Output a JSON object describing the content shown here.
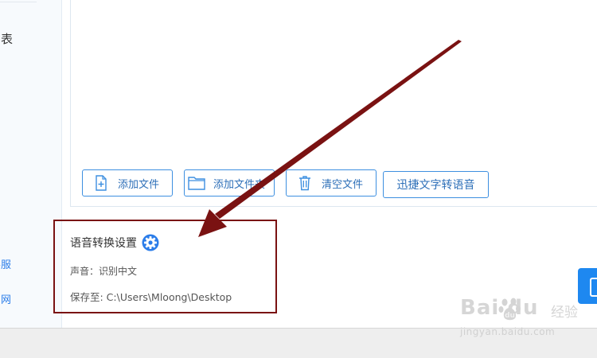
{
  "sidebar": {
    "list_label": "列表",
    "service_label": "客服",
    "site_label": "官网"
  },
  "toolbar": {
    "add_file_label": "添加文件",
    "add_folder_label": "添加文件夹",
    "clear_files_label": "清空文件",
    "tts_label": "迅捷文字转语音"
  },
  "settings": {
    "title": "语音转换设置",
    "voice": "声音：识别中文",
    "save_to": "保存至: C:\\Users\\Mloong\\Desktop"
  },
  "watermark": {
    "logo_text": "Bai  du",
    "logo_suffix": "经验",
    "url": "jingyan.baidu.com"
  },
  "colors": {
    "accent": "#2b7de9",
    "annotation": "#7a1212",
    "start_button": "#1e88f0"
  },
  "icons": [
    "add-file-icon",
    "folder-icon",
    "trash-icon",
    "gear-icon",
    "annotation-arrow",
    "baidu-paw-icon"
  ]
}
